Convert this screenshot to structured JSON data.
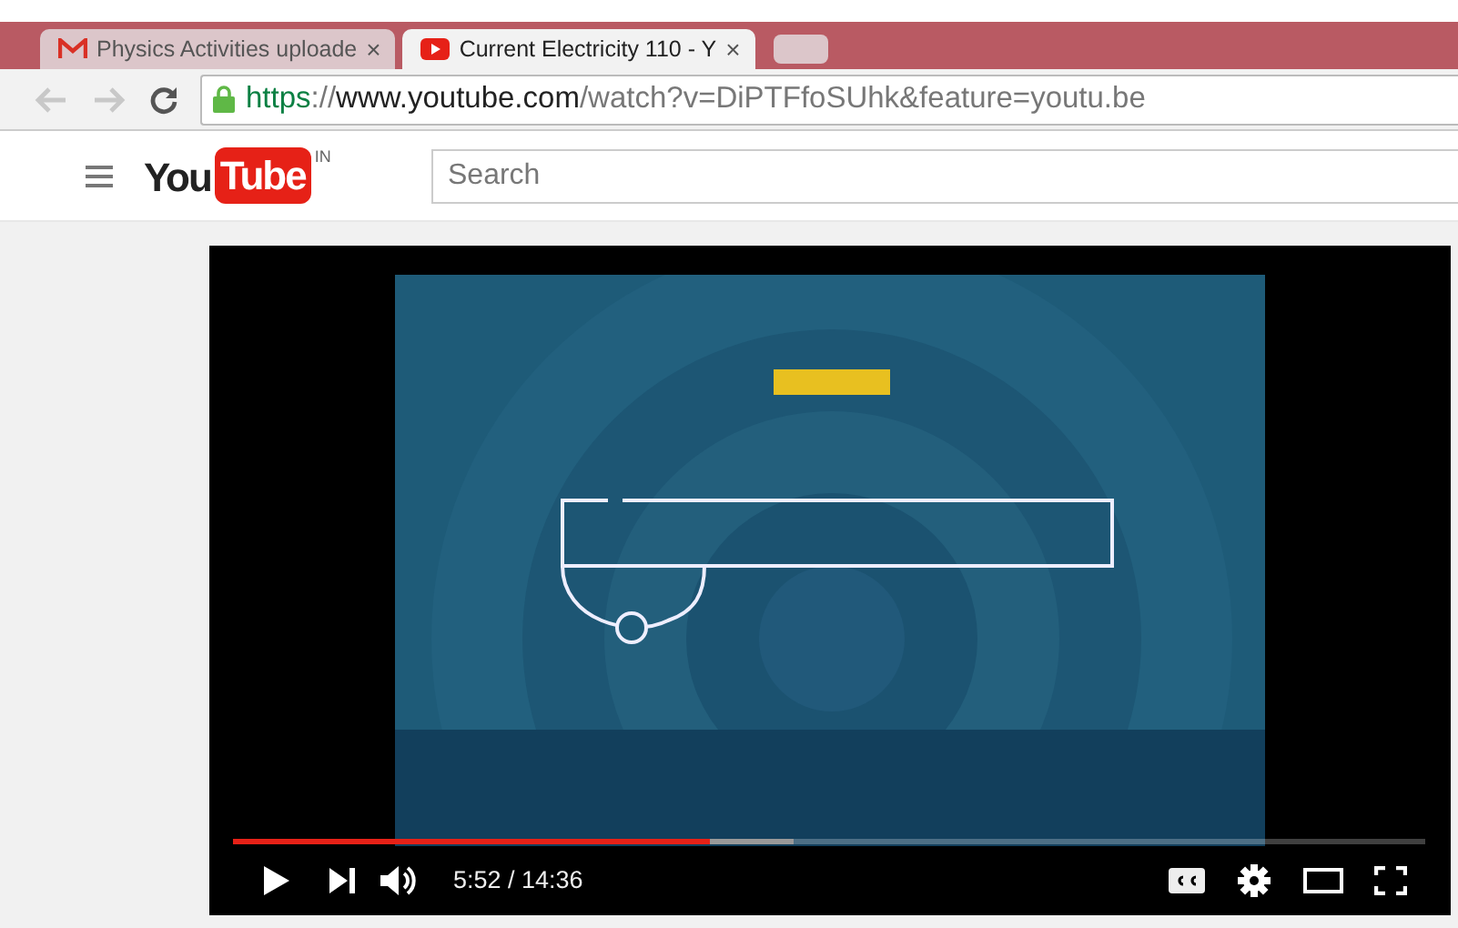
{
  "tabs": [
    {
      "title": "Physics Activities uploade",
      "close": "×",
      "selected": false
    },
    {
      "title": "Current Electricity 110 - Y",
      "close": "×",
      "selected": true
    }
  ],
  "address": {
    "parts": [
      {
        "kind": "scheme",
        "text": "https"
      },
      {
        "kind": "separator",
        "text": "://"
      },
      {
        "kind": "host",
        "text": "www.youtube.com"
      },
      {
        "kind": "path",
        "text": "/watch?v=DiPTFfoSUhk&feature=youtu.be"
      }
    ]
  },
  "header": {
    "logo_you": "You",
    "logo_tube": "Tube",
    "region": "IN",
    "search": {
      "placeholder": "Search"
    }
  },
  "player": {
    "progress": {
      "level": 0.4,
      "buffer": {
        "level": 0.47
      }
    },
    "time": "5:52 / 14:36"
  }
}
